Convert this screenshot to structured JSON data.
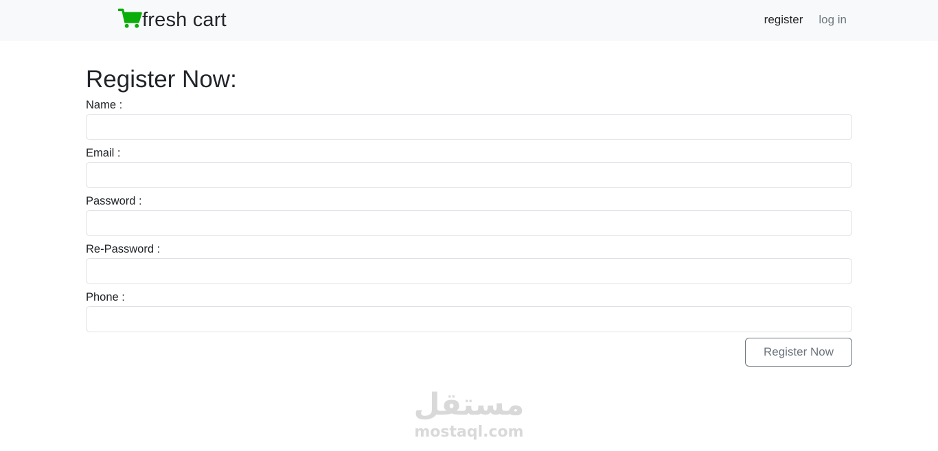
{
  "navbar": {
    "brand": "fresh cart",
    "brand_icon": "shopping-cart-icon",
    "brand_color": "#0aad0a",
    "links": [
      {
        "label": "register",
        "active": true
      },
      {
        "label": "log in",
        "active": false
      }
    ]
  },
  "form": {
    "title": "Register Now:",
    "fields": [
      {
        "label": "Name :",
        "value": ""
      },
      {
        "label": "Email :",
        "value": ""
      },
      {
        "label": "Password :",
        "value": ""
      },
      {
        "label": "Re-Password :",
        "value": ""
      },
      {
        "label": "Phone :",
        "value": ""
      }
    ],
    "submit_label": "Register Now"
  },
  "watermark": {
    "arabic": "مستقل",
    "latin": "mostaql.com"
  }
}
